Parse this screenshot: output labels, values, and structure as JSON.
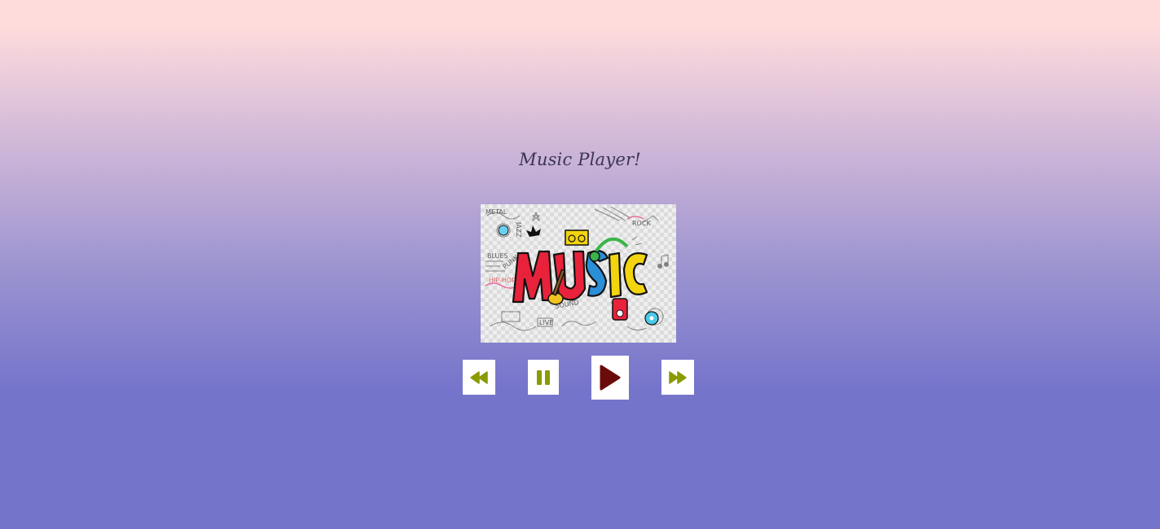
{
  "page": {
    "title": "Music Player!"
  },
  "artwork": {
    "logo_text": "MUSIC",
    "icon": "music-doodle-art"
  },
  "controls": {
    "rewind": {
      "icon": "rewind-icon",
      "color": "#8a9a00"
    },
    "pause": {
      "icon": "pause-icon",
      "color": "#8a9a00"
    },
    "play": {
      "icon": "play-icon",
      "color": "#6b0a0a"
    },
    "forward": {
      "icon": "fast-forward-icon",
      "color": "#8a9a00"
    }
  },
  "colors": {
    "gradient_top": "#ffdcdc",
    "gradient_bottom": "#7574cb",
    "title_text": "#3a3550"
  }
}
